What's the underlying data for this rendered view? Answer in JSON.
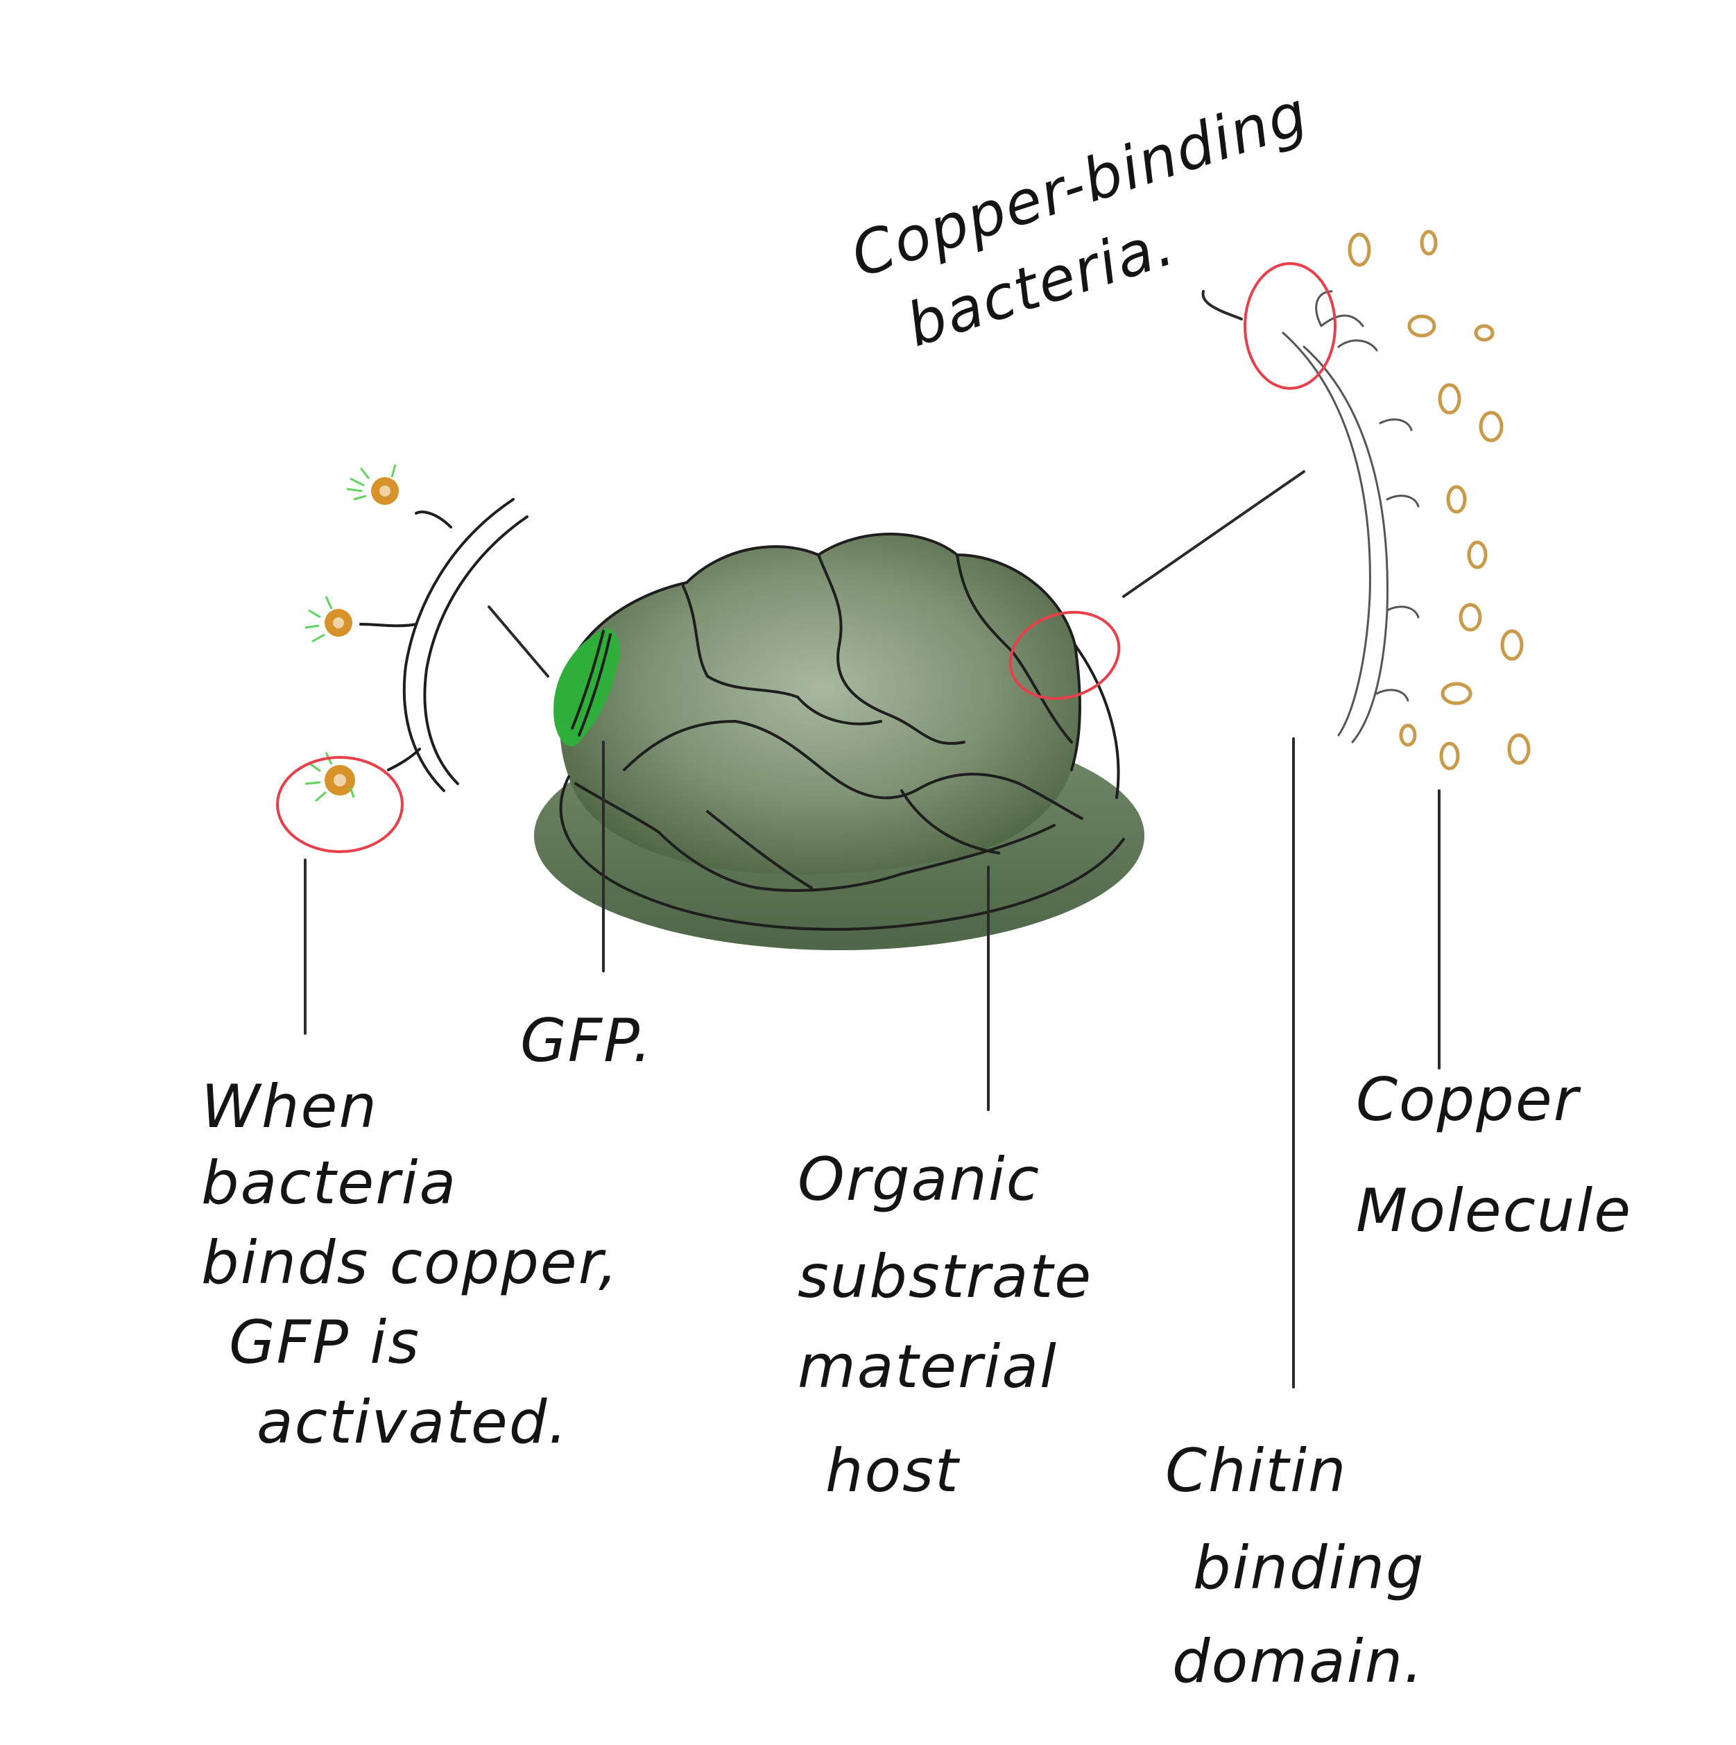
{
  "labels": {
    "copper_binding_bacteria": [
      "Copper-binding",
      "bacteria."
    ],
    "activation_note": [
      "When",
      "bacteria",
      "binds copper,",
      "GFP is",
      "activated."
    ],
    "gfp": "GFP.",
    "substrate": [
      "Organic",
      "substrate",
      "material",
      "host"
    ],
    "copper_molecule": [
      "Copper",
      "Molecule"
    ],
    "chitin": [
      "Chitin",
      "binding",
      "domain."
    ]
  },
  "colors": {
    "gfp_green": "#2fae3c",
    "substrate_green": "#6c7e60",
    "substrate_dark": "#3f5a33",
    "copper_orange": "#d8922a",
    "copper_molecule": "#c89a4a",
    "highlight_red": "#e8404a",
    "glow_green": "#5fd45a"
  }
}
